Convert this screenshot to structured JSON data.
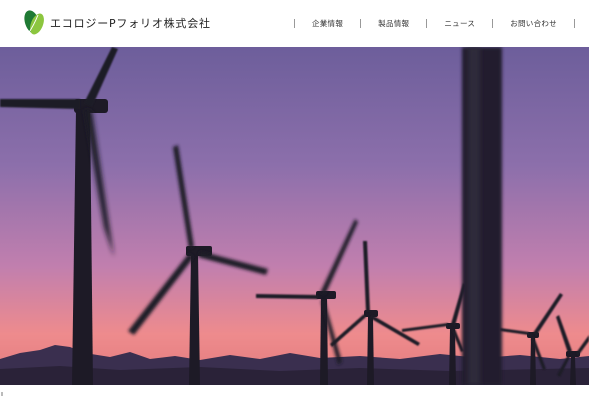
{
  "brand": {
    "name": "エコロジーPフォリオ株式会社",
    "logo_icon": "leaf-icon",
    "colors": {
      "leaf_dark": "#1f7a34",
      "leaf_light": "#8cc63f"
    }
  },
  "nav": {
    "items": [
      {
        "label": "企業情報"
      },
      {
        "label": "製品情報"
      },
      {
        "label": "ニュース"
      },
      {
        "label": "お問い合わせ"
      }
    ]
  },
  "hero": {
    "image": "wind-turbines-at-sunset",
    "sky_colors": {
      "top": "#6f5f9c",
      "middle": "#b27fb4",
      "horizon": "#f08a86"
    }
  }
}
